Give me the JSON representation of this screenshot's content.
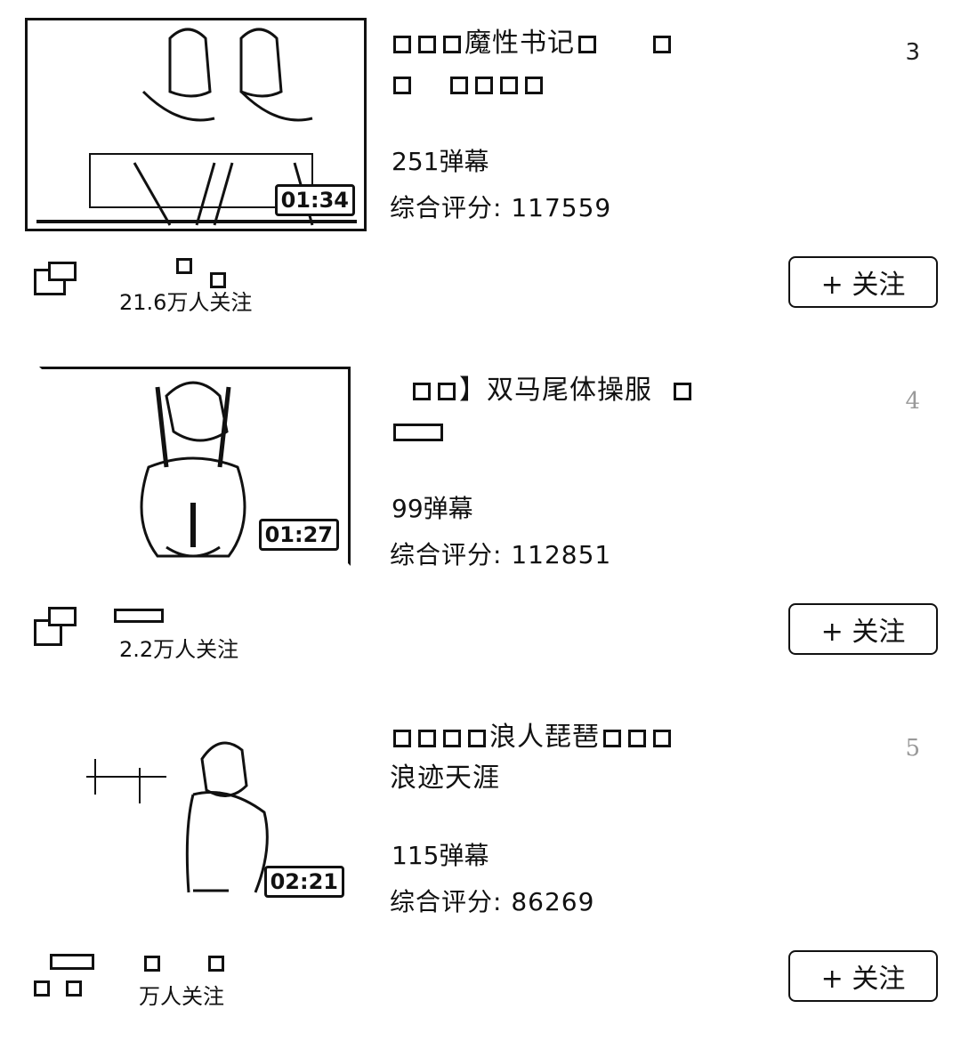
{
  "items": [
    {
      "rank": "3",
      "title_line1": "魔性书记",
      "title_line2": "",
      "duration": "01:34",
      "danmaku": "251弹幕",
      "score": "综合评分: 117559",
      "followers": "21.6万人关注",
      "follow_label": "+ 关注"
    },
    {
      "rank": "4",
      "title_line1": "】双马尾体操服",
      "title_line2": "",
      "duration": "01:27",
      "danmaku": "99弹幕",
      "score": "综合评分: 112851",
      "followers": "2.2万人关注",
      "follow_label": "+ 关注"
    },
    {
      "rank": "5",
      "title_line1": "浪人琵琶",
      "title_line2": "浪迹天涯",
      "duration": "02:21",
      "danmaku": "115弹幕",
      "score": "综合评分: 86269",
      "followers": "万人关注",
      "follow_label": "+ 关注"
    }
  ]
}
